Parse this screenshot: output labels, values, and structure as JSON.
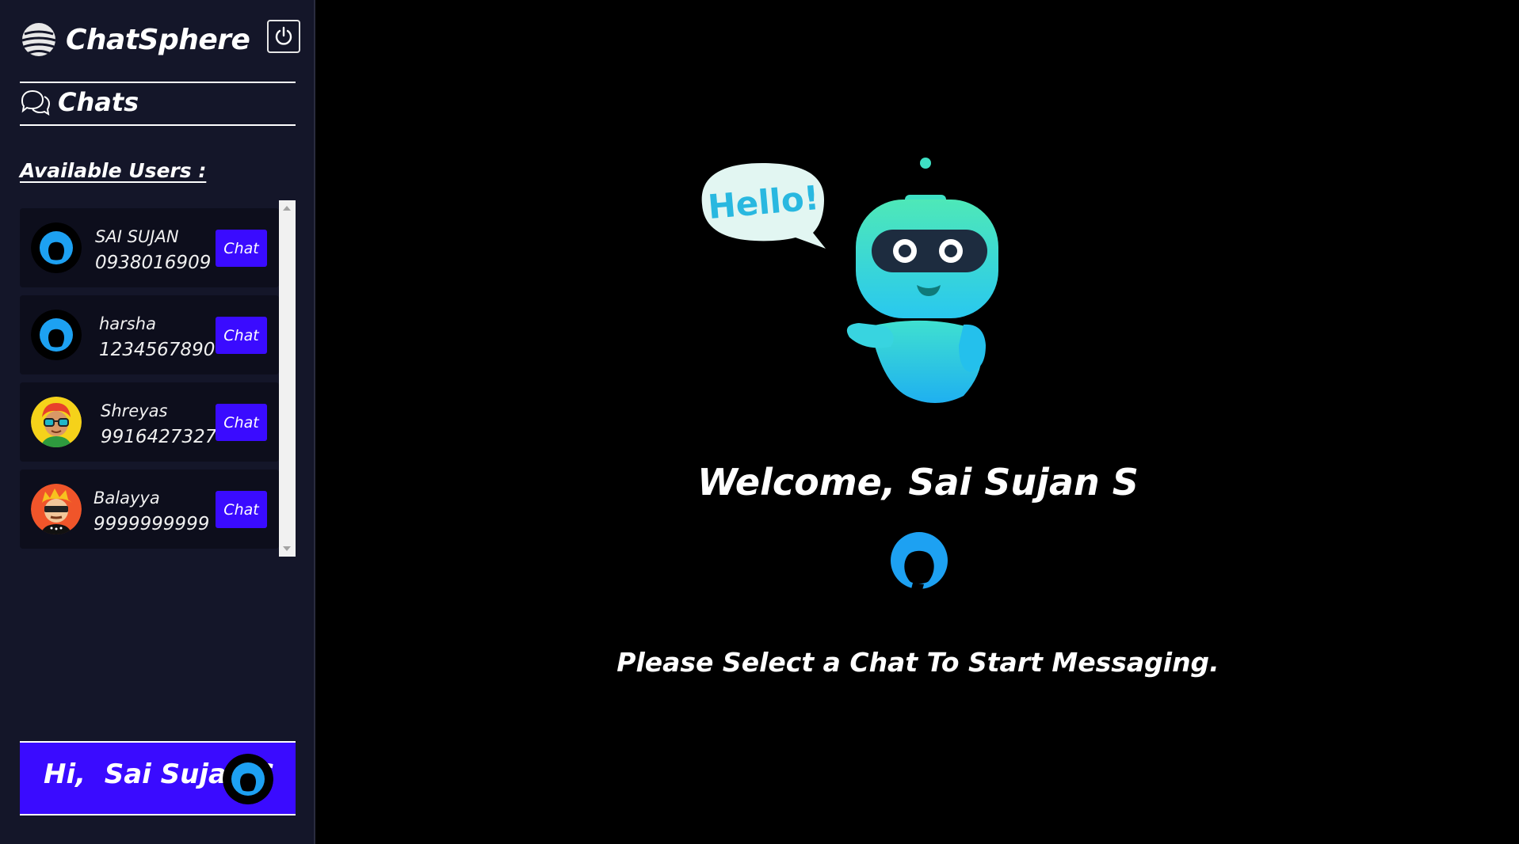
{
  "app": {
    "name": "ChatSphere",
    "logo_icon": "globe-stack-icon",
    "power_icon": "power-icon"
  },
  "sidebar": {
    "chats_label": "Chats",
    "chats_icon": "chat-bubbles-icon",
    "available_label": "Available Users :",
    "users": [
      {
        "name": "SAI SUJAN",
        "phone": "0938016909",
        "avatar": "default-silhouette",
        "chat_label": "Chat"
      },
      {
        "name": "harsha",
        "phone": "1234567890",
        "avatar": "default-silhouette",
        "chat_label": "Chat"
      },
      {
        "name": "Shreyas",
        "phone": "9916427327",
        "avatar": "cartoon-red-hair-glasses",
        "chat_label": "Chat"
      },
      {
        "name": "Balayya",
        "phone": "9999999999",
        "avatar": "cartoon-sunglasses",
        "chat_label": "Chat"
      }
    ],
    "greeting_prefix": "Hi,",
    "current_user": "Sai Sujan S"
  },
  "main": {
    "welcome": "Welcome, Sai Sujan S",
    "bubble_text": "Hello!",
    "prompt": "Please Select a Chat To Start Messaging."
  },
  "colors": {
    "sidebar_bg": "#141629",
    "card_bg": "#0d0e1c",
    "accent": "#3a0bff",
    "avatar_blue": "#1da1f2",
    "robot_teal": "#3ee0c4"
  }
}
